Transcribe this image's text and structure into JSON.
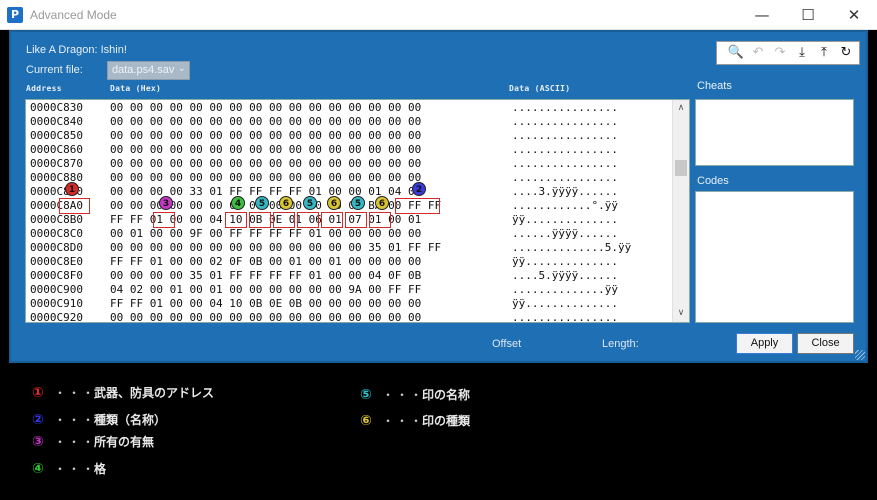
{
  "window": {
    "title": "Advanced Mode",
    "app_icon": "P"
  },
  "header": {
    "game_title": "Like A Dragon: Ishin!",
    "current_file_label": "Current file:",
    "current_file_value": "data.ps4.sav"
  },
  "columns": {
    "address": "Address",
    "data_hex": "Data (Hex)",
    "data_ascii": "Data (ASCII)"
  },
  "side": {
    "cheats_label": "Cheats",
    "codes_label": "Codes"
  },
  "hex_rows": [
    {
      "addr": "0000C830",
      "bytes": "00 00 00 00 00 00 00 00 00 00 00 00 00 00 00 00",
      "ascii": "................"
    },
    {
      "addr": "0000C840",
      "bytes": "00 00 00 00 00 00 00 00 00 00 00 00 00 00 00 00",
      "ascii": "................"
    },
    {
      "addr": "0000C850",
      "bytes": "00 00 00 00 00 00 00 00 00 00 00 00 00 00 00 00",
      "ascii": "................"
    },
    {
      "addr": "0000C860",
      "bytes": "00 00 00 00 00 00 00 00 00 00 00 00 00 00 00 00",
      "ascii": "................"
    },
    {
      "addr": "0000C870",
      "bytes": "00 00 00 00 00 00 00 00 00 00 00 00 00 00 00 00",
      "ascii": "................"
    },
    {
      "addr": "0000C880",
      "bytes": "00 00 00 00 00 00 00 00 00 00 00 00 00 00 00 00",
      "ascii": "................"
    },
    {
      "addr": "0000C890",
      "bytes": "00 00 00 00 33 01 FF FF FF FF 01 00 00 01 04 03",
      "ascii": "....3.ÿÿÿÿ......"
    },
    {
      "addr": "0000C8A0",
      "bytes": "00 00 00 00 00 00 00 00 00 00 00 00 00 BA 00 FF FF",
      "ascii": "............°.ÿÿ"
    },
    {
      "addr": "0000C8B0",
      "bytes": "FF FF 01 00 00 04 10 0B 0E 01 06 01 07 01 00 01",
      "ascii": "ÿÿ.............."
    },
    {
      "addr": "0000C8C0",
      "bytes": "00 01 00 00 9F 00 FF FF FF FF 01 00 00 00 00 00",
      "ascii": "......ÿÿÿÿ......"
    },
    {
      "addr": "0000C8D0",
      "bytes": "00 00 00 00 00 00 00 00 00 00 00 00 00 35 01 FF FF",
      "ascii": "..............5.ÿÿ"
    },
    {
      "addr": "0000C8E0",
      "bytes": "FF FF 01 00 00 02 0F 0B 00 01 00 01 00 00 00 00",
      "ascii": "ÿÿ.............."
    },
    {
      "addr": "0000C8F0",
      "bytes": "00 00 00 00 35 01 FF FF FF FF 01 00 00 04 0F 0B",
      "ascii": "....5.ÿÿÿÿ......"
    },
    {
      "addr": "0000C900",
      "bytes": "04 02 00 01 00 01 00 00 00 00 00 00 9A 00 FF FF",
      "ascii": "..............ÿÿ"
    },
    {
      "addr": "0000C910",
      "bytes": "FF FF 01 00 00 04 10 0B 0E 0B 00 00 00 00 00 00",
      "ascii": "ÿÿ.............."
    },
    {
      "addr": "0000C920",
      "bytes": "00 00 00 00 00 00 00 00 00 00 00 00 00 00 00 00",
      "ascii": "................"
    }
  ],
  "markers": [
    {
      "label": "1",
      "color": "#d42a2a"
    },
    {
      "label": "3",
      "color": "#c238c2"
    },
    {
      "label": "4",
      "color": "#3fbf3f"
    },
    {
      "label": "5",
      "color": "#35b7c4"
    },
    {
      "label": "6",
      "color": "#d9c332"
    },
    {
      "label": "5",
      "color": "#35b7c4"
    },
    {
      "label": "6",
      "color": "#d9c332"
    },
    {
      "label": "5",
      "color": "#35b7c4"
    },
    {
      "label": "6",
      "color": "#d9c332"
    },
    {
      "label": "2",
      "color": "#3a3ad8"
    }
  ],
  "footer": {
    "offset_label": "Offset",
    "length_label": "Length:",
    "apply_label": "Apply",
    "close_label": "Close"
  },
  "legend": [
    {
      "num": "①",
      "dots": "・・・",
      "text": "武器、防具のアドレス",
      "color": "#e02828"
    },
    {
      "num": "②",
      "dots": "・・・",
      "text": "種類（名称）",
      "color": "#3535e0"
    },
    {
      "num": "③",
      "dots": "・・・",
      "text": "所有の有無",
      "color": "#c030c0"
    },
    {
      "num": "④",
      "dots": "・・・",
      "text": "格",
      "color": "#30c030"
    },
    {
      "num": "⑤",
      "dots": "・・・",
      "text": "印の名称",
      "color": "#30c0c8"
    },
    {
      "num": "⑥",
      "dots": "・・・",
      "text": "印の種類",
      "color": "#d8c030"
    }
  ],
  "icons": {
    "search": "🔍",
    "undo": "↶",
    "redo": "↷",
    "import": "⤓",
    "export": "⤒",
    "refresh": "↻",
    "minimize": "—",
    "maximize": "☐",
    "close": "✕",
    "scroll_up": "∧",
    "scroll_down": "∨",
    "dropdown": "⌄"
  }
}
